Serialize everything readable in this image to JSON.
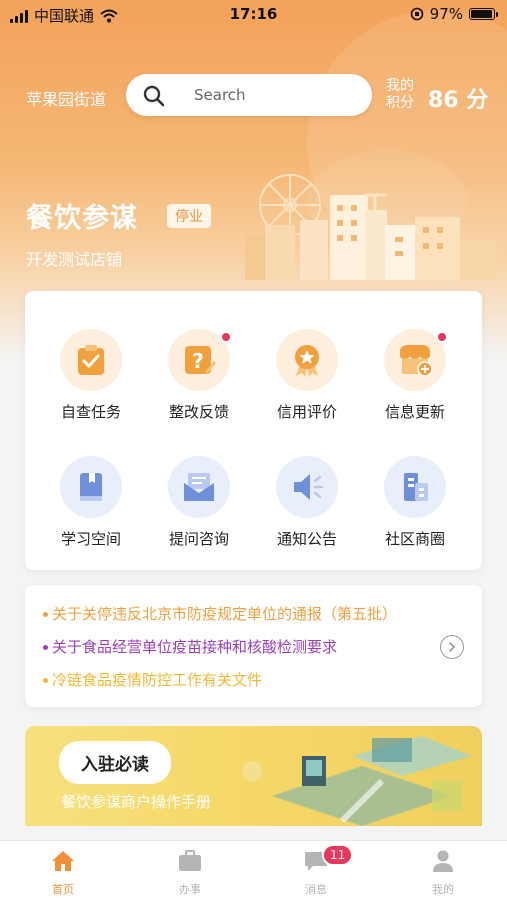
{
  "status_bar": {
    "carrier": "中国联通",
    "time": "17:16",
    "battery": "97%",
    "battery_level": 0.97
  },
  "header": {
    "street": "苹果园街道",
    "search_placeholder": "Search",
    "points_label": "我的积分",
    "points_value": "86 分"
  },
  "store": {
    "name": "餐饮参谋",
    "status_badge": "停业",
    "subtitle": "开发测试店铺"
  },
  "grid": [
    {
      "label": "自查任务",
      "icon": "clipboard-check-icon",
      "dot": false
    },
    {
      "label": "整改反馈",
      "icon": "question-edit-icon",
      "dot": true
    },
    {
      "label": "信用评价",
      "icon": "medal-star-icon",
      "dot": false
    },
    {
      "label": "信息更新",
      "icon": "shop-add-icon",
      "dot": true
    },
    {
      "label": "学习空间",
      "icon": "book-icon",
      "dot": false
    },
    {
      "label": "提问咨询",
      "icon": "mail-icon",
      "dot": false
    },
    {
      "label": "通知公告",
      "icon": "speaker-icon",
      "dot": false
    },
    {
      "label": "社区商圈",
      "icon": "buildings-icon",
      "dot": false
    }
  ],
  "notices": [
    {
      "text": "关于关停违反北京市防疫规定单位的通报（第五批）",
      "color": "#f0a040"
    },
    {
      "text": "关于食品经营单位疫苗接种和核酸检测要求",
      "color": "#9b3fb8"
    },
    {
      "text": "冷链食品疫情防控工作有关文件",
      "color": "#f0b830"
    }
  ],
  "banner": {
    "pill": "入驻必读",
    "subtitle": "餐饮参谋商户操作手册"
  },
  "tabs": [
    {
      "label": "首页",
      "icon": "home-icon",
      "active": true
    },
    {
      "label": "办事",
      "icon": "briefcase-icon",
      "active": false
    },
    {
      "label": "消息",
      "icon": "message-icon",
      "active": false,
      "badge": "11"
    },
    {
      "label": "我的",
      "icon": "user-icon",
      "active": false
    }
  ],
  "colors": {
    "accent": "#f0913a",
    "hero_top": "#f3a25a",
    "tab_inactive": "#b5b5b5",
    "badge_red": "#e8365d"
  }
}
